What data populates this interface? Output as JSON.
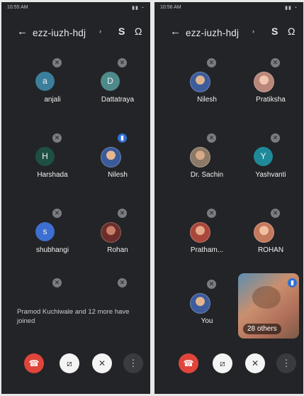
{
  "left": {
    "status_time": "10:55 AM",
    "meeting_code": "ezz-iuzh-hdj",
    "participants": [
      {
        "name": "anjali",
        "initial": "a",
        "color": "#3b7f9c"
      },
      {
        "name": "Dattatraya",
        "initial": "D",
        "color": "#4f8a8b"
      },
      {
        "name": "Harshada",
        "initial": "H",
        "color": "#1d4f45"
      },
      {
        "name": "Nilesh",
        "initial": "",
        "color": "#7a9bd0"
      },
      {
        "name": "shubhangi",
        "initial": "s",
        "color": "#3d6fd0"
      },
      {
        "name": "Rohan",
        "initial": "",
        "color": "#a35d50"
      }
    ],
    "joined_msg": "Pramod Kuchiwale and 12 more have joined"
  },
  "right": {
    "status_time": "10:56 AM",
    "meeting_code": "ezz-iuzh-hdj",
    "participants": [
      {
        "name": "Nilesh",
        "initial": "",
        "color": "#7a9bd0"
      },
      {
        "name": "Pratiksha",
        "initial": "",
        "color": "#d2a79a"
      },
      {
        "name": "Dr. Sachin",
        "initial": "",
        "color": "#b39a7e"
      },
      {
        "name": "Yashvanti",
        "initial": "Y",
        "color": "#1e8a99"
      },
      {
        "name": "Pratham...",
        "initial": "",
        "color": "#b04a3e"
      },
      {
        "name": "ROHAN",
        "initial": "",
        "color": "#cf8b6f"
      },
      {
        "name": "You",
        "initial": "",
        "color": "#7a9bd0"
      }
    ],
    "others_label": "28 others"
  },
  "icons": {
    "back": "←",
    "chevron": "›",
    "sync": "S",
    "audio": "Ω",
    "mic_off": "✕",
    "mic_on": "▮",
    "end_call": "☎",
    "camera_off": "⧄",
    "mic_toggle": "✕",
    "more": "⋮"
  },
  "colors": {
    "background": "#232427",
    "end_call": "#e0453b",
    "active_speaker": "#2f6fd6"
  }
}
